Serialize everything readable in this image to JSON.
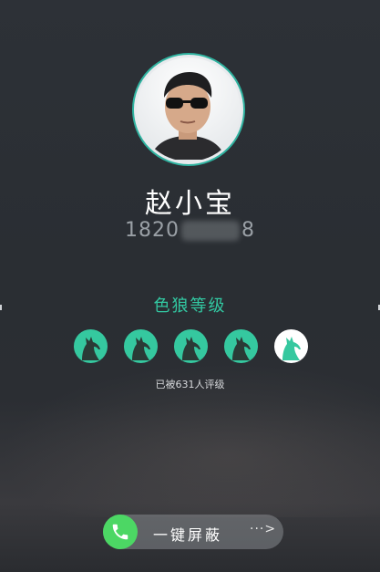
{
  "contact": {
    "name": "赵小宝",
    "phone_prefix": "1820",
    "phone_suffix": "8"
  },
  "rating": {
    "title": "色狼等级",
    "level": 4,
    "max": 5,
    "rated_text": "已被631人评级"
  },
  "actions": {
    "block_label": "一键屏蔽",
    "more_label": "···>"
  },
  "colors": {
    "accent": "#32c8a2",
    "wolf_filled": "#35c89f",
    "call_green": "#4cd764"
  },
  "icons": {
    "call": "phone-icon",
    "wolf": "wolf-icon"
  }
}
